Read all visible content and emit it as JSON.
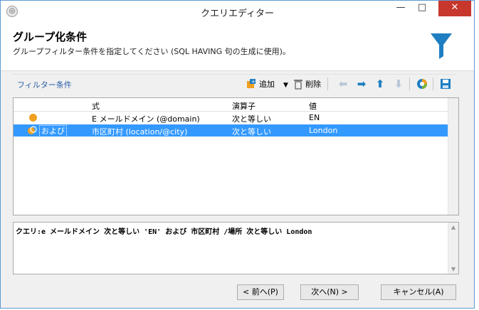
{
  "window": {
    "title": "クエリエディター",
    "minimize": "—",
    "maximize": "□",
    "close": "✕"
  },
  "header": {
    "title": "グループ化条件",
    "subtitle": "グループフィルター条件を指定してください (SQL HAVING 句の生成に使用)。"
  },
  "toolbar": {
    "section_label": "フィルター条件",
    "add_label": "追加",
    "delete_label": "削除"
  },
  "grid": {
    "columns": [
      "式",
      "演算子",
      "値"
    ],
    "rows": [
      {
        "prefix": "",
        "expression": "E メールドメイン (@domain)",
        "operator": "次と等しい",
        "value": "EN",
        "selected": false
      },
      {
        "prefix": "および",
        "expression": "市区町村 (location/@city)",
        "operator": "次と等しい",
        "value": "London",
        "selected": true
      }
    ]
  },
  "query": {
    "text": "クエリ:e メールドメイン 次と等しい 'EN' および 市区町村 /場所 次と等しい London"
  },
  "buttons": {
    "prev": "< 前へ(P)",
    "next": "次へ(N) >",
    "cancel": "キャンセル(A)"
  },
  "colors": {
    "accent": "#3399ff",
    "funnel": "#1f7ec2",
    "close": "#c7372c",
    "condition_icon": "#f0a020"
  }
}
